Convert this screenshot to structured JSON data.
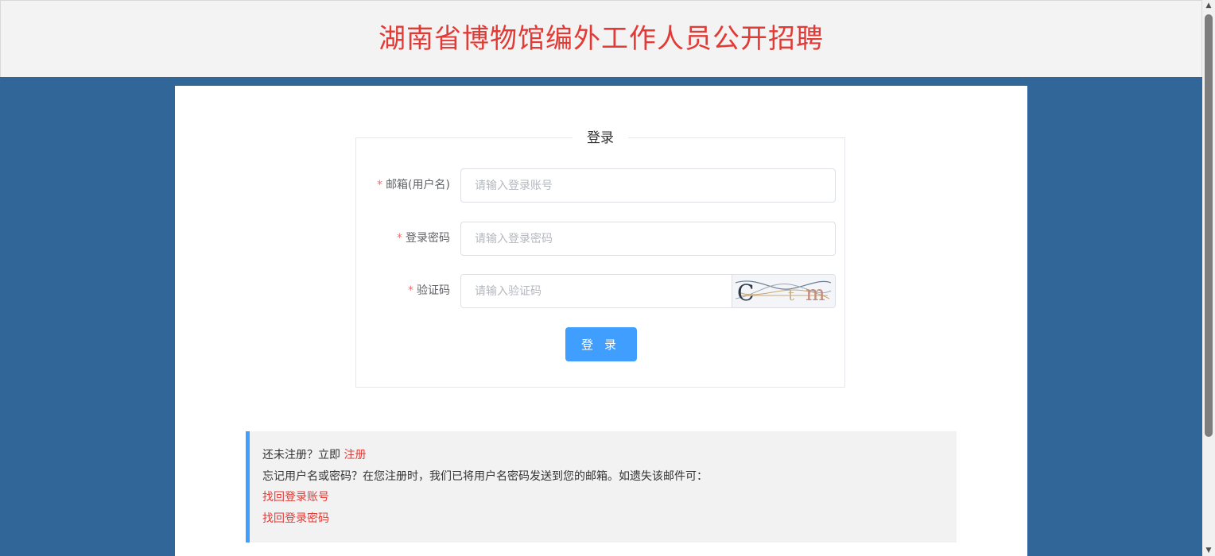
{
  "header": {
    "title": "湖南省博物馆编外工作人员公开招聘"
  },
  "login": {
    "legend_a": "登",
    "legend_b": "录",
    "required_mark": "*",
    "fields": {
      "email": {
        "label": "邮箱(用户名)",
        "placeholder": "请输入登录账号"
      },
      "password": {
        "label": "登录密码",
        "placeholder": "请输入登录密码"
      },
      "captcha": {
        "label": "验证码",
        "placeholder": "请输入验证码",
        "image_text": "C t m"
      }
    },
    "submit_label": "登录"
  },
  "notice": {
    "line1_text": "还未注册？立即 ",
    "register_link": "注册",
    "line2_text": "忘记用户名或密码？在您注册时，我们已将用户名密码发送到您的邮箱。如遗失该邮件可：",
    "find_account_link": "找回登录账号",
    "find_password_link": "找回登录密码"
  },
  "colors": {
    "title_red": "#e23a35",
    "page_blue": "#316699",
    "primary_button": "#409eff"
  }
}
